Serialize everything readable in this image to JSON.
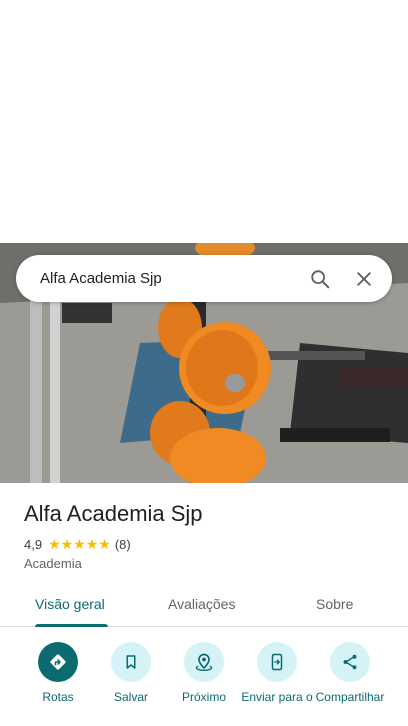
{
  "search": {
    "query": "Alfa Academia Sjp"
  },
  "place": {
    "name": "Alfa Academia Sjp",
    "rating": "4,9",
    "stars": "★★★★★",
    "review_count": "(8)",
    "category": "Academia"
  },
  "tabs": [
    {
      "label": "Visão geral",
      "active": true
    },
    {
      "label": "Avaliações",
      "active": false
    },
    {
      "label": "Sobre",
      "active": false
    }
  ],
  "actions": [
    {
      "label": "Rotas",
      "icon": "directions-icon"
    },
    {
      "label": "Salvar",
      "icon": "bookmark-icon"
    },
    {
      "label": "Próximo",
      "icon": "nearby-icon"
    },
    {
      "label": "Enviar para o",
      "icon": "send-to-phone-icon"
    },
    {
      "label": "Compartilhar",
      "icon": "share-icon"
    }
  ],
  "colors": {
    "accent": "#0b6b71",
    "accent_light": "#d5f3f6",
    "star": "#fbbc04"
  }
}
